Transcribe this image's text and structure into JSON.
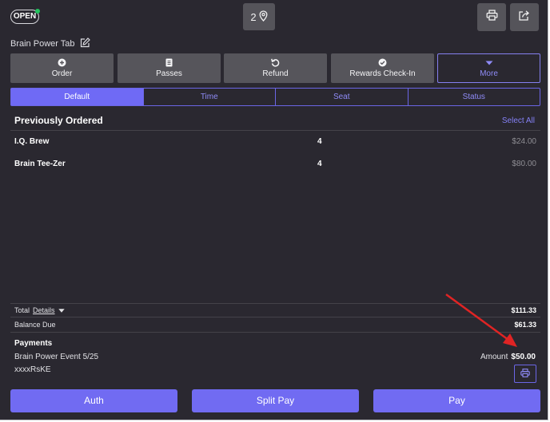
{
  "status_badge": "OPEN",
  "seat": {
    "count": "2",
    "icon": "location-pin-icon"
  },
  "toolbar": {
    "print_icon": "printer-icon",
    "share_icon": "share-icon"
  },
  "tab_name": "Brain Power Tab",
  "actions": [
    {
      "label": "Order",
      "icon": "plus-circle-icon"
    },
    {
      "label": "Passes",
      "icon": "ticket-icon"
    },
    {
      "label": "Refund",
      "icon": "undo-icon"
    },
    {
      "label": "Rewards Check-In",
      "icon": "check-circle-icon"
    },
    {
      "label": "More",
      "icon": "caret-down-icon"
    }
  ],
  "segments": [
    {
      "label": "Default",
      "active": true
    },
    {
      "label": "Time",
      "active": false
    },
    {
      "label": "Seat",
      "active": false
    },
    {
      "label": "Status",
      "active": false
    }
  ],
  "ordered": {
    "heading": "Previously Ordered",
    "select_all": "Select All",
    "items": [
      {
        "name": "I.Q. Brew",
        "qty": "4",
        "price": "$24.00"
      },
      {
        "name": "Brain Tee-Zer",
        "qty": "4",
        "price": "$80.00"
      }
    ]
  },
  "totals": {
    "total_label": "Total",
    "details_label": "Details",
    "total_value": "$111.33",
    "balance_label": "Balance Due",
    "balance_value": "$61.33"
  },
  "payments": {
    "heading": "Payments",
    "name": "Brain Power Event 5/25",
    "card": "xxxxRsKE",
    "amount_label": "Amount",
    "amount_value": "$50.00"
  },
  "bottom": {
    "auth": "Auth",
    "split_pay": "Split Pay",
    "pay": "Pay"
  },
  "colors": {
    "background": "#2a2830",
    "accent": "#716bf2",
    "button": "#56555b",
    "annotation_arrow": "#e02424"
  }
}
